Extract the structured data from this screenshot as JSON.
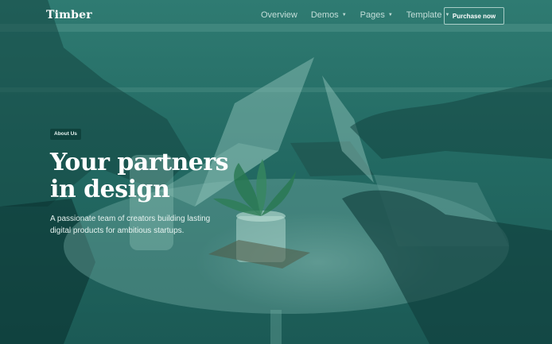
{
  "header": {
    "logo": "Timber",
    "nav": [
      {
        "label": "Overview",
        "dropdown": false
      },
      {
        "label": "Demos",
        "dropdown": true
      },
      {
        "label": "Pages",
        "dropdown": true
      },
      {
        "label": "Template",
        "dropdown": true
      }
    ],
    "purchase_label": "Purchase now"
  },
  "hero": {
    "badge": "About Us",
    "headline_line1": "Your partners",
    "headline_line2": "in design",
    "subtext_line1": "A passionate team of creators building lasting",
    "subtext_line2": "digital products for ambitious startups."
  },
  "colors": {
    "overlay": "#236a63",
    "text": "#ffffff",
    "badge_bg": "#0c3c37"
  }
}
